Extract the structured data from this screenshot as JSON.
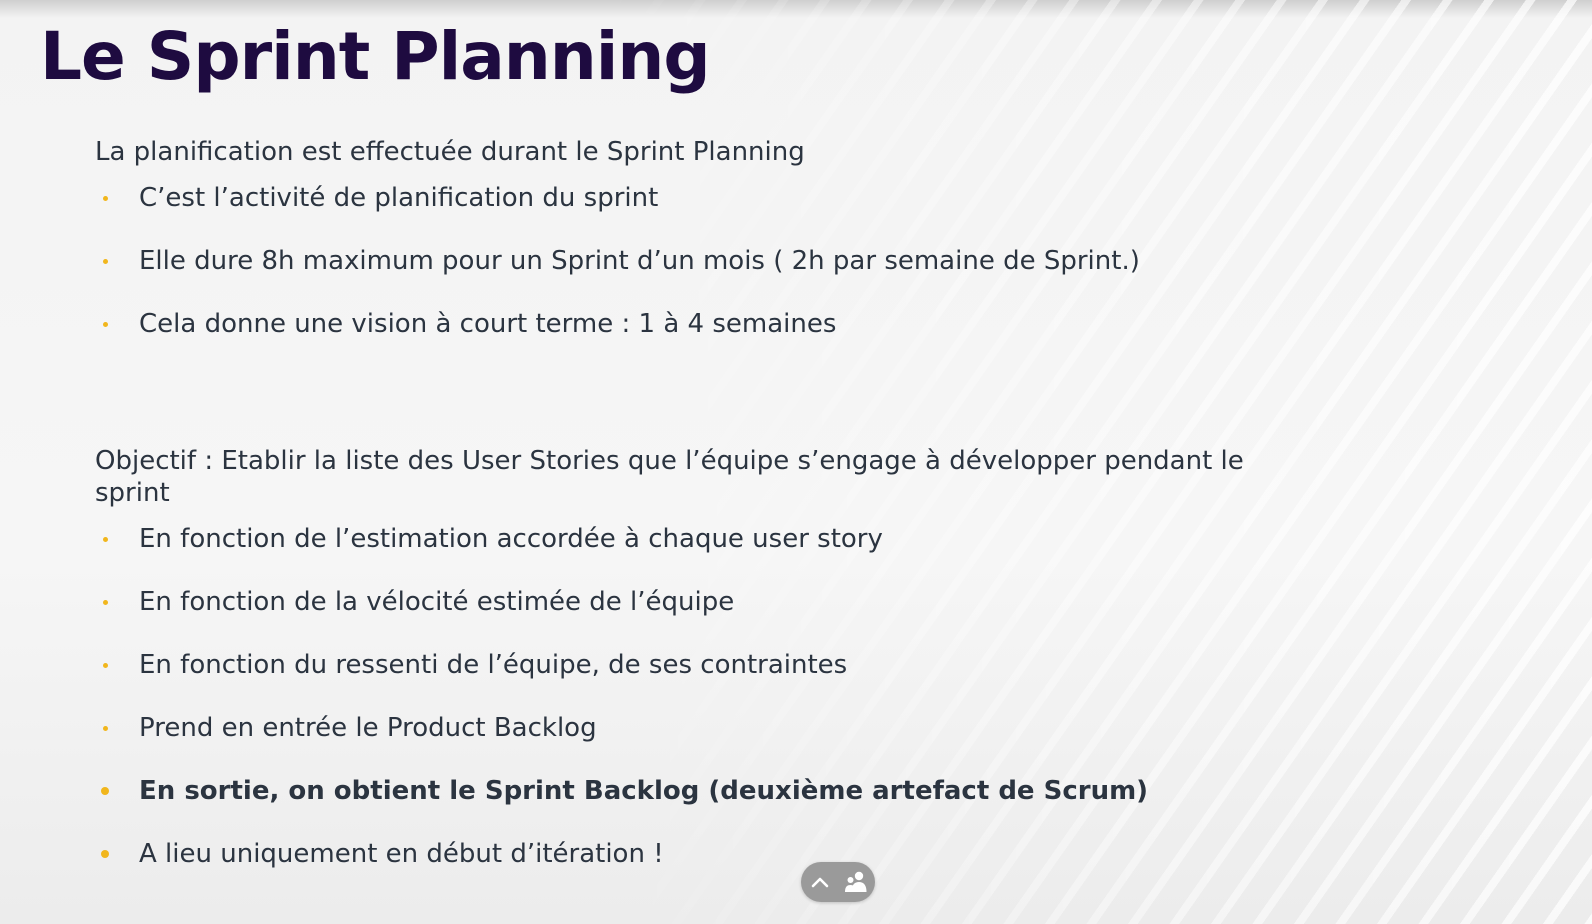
{
  "slide": {
    "title": "Le Sprint Planning",
    "intro": "La planification est effectuée durant le Sprint Planning",
    "intro_bullets": [
      "C’est l’activité de planification du sprint",
      "Elle dure 8h maximum pour un Sprint d’un mois ( 2h par semaine de Sprint.)",
      "Cela donne une vision à court terme : 1 à 4 semaines"
    ],
    "objective": "Objectif : Etablir la liste des User Stories que l’équipe s’engage à développer pendant le sprint",
    "objective_bullets": [
      "En fonction de l’estimation accordée à chaque user story",
      "En fonction de la vélocité estimée de l’équipe",
      "En fonction du ressenti de l’équipe, de ses contraintes",
      "Prend en entrée le Product Backlog",
      "En sortie, on obtient le Sprint Backlog (deuxième artefact de Scrum)",
      "A lieu uniquement en début d’itération !"
    ]
  },
  "toolbar": {
    "icons": [
      "chevron-up-icon",
      "participants-icon"
    ]
  },
  "colors": {
    "title": "#1e0b40",
    "text": "#2b3440",
    "bullet": "#f1b61c",
    "toolbar": "#9a9a9a"
  }
}
